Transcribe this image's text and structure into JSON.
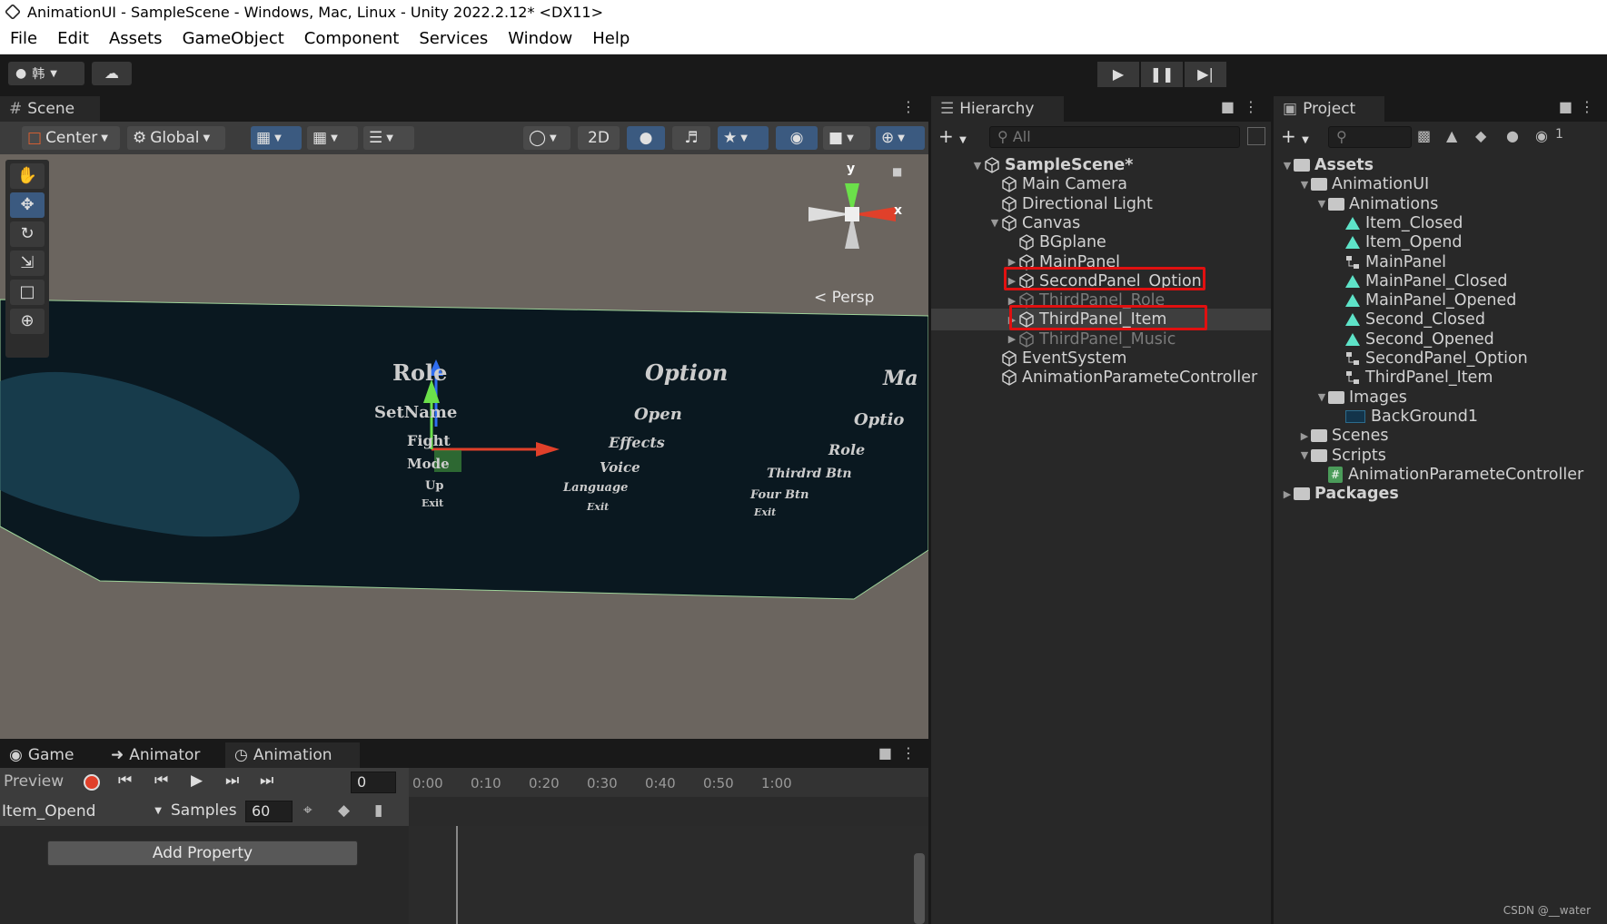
{
  "window": {
    "title": "AnimationUI - SampleScene - Windows, Mac, Linux - Unity 2022.2.12* <DX11>"
  },
  "menu": [
    "File",
    "Edit",
    "Assets",
    "GameObject",
    "Component",
    "Services",
    "Window",
    "Help"
  ],
  "toolbar": {
    "account": "韩",
    "play_icon": "play-icon",
    "pause_icon": "pause-icon",
    "step_icon": "step-icon"
  },
  "scene": {
    "tab": "Scene",
    "pivot": "Center",
    "space": "Global",
    "mode_2d": "2D",
    "persp_label": "< Persp",
    "gizmo_y": "y",
    "gizmo_x": "x",
    "labels_left": [
      "Role",
      "SetName",
      "Fight",
      "Mode",
      "Up",
      "Exit"
    ],
    "labels_mid": [
      "Option",
      "Open",
      "Effects",
      "Voice",
      "Language",
      "Exit"
    ],
    "labels_right": [
      "Ma",
      "Optio",
      "Role",
      "Thirdrd Btn",
      "Four Btn",
      "Exit"
    ]
  },
  "hierarchy": {
    "tab": "Hierarchy",
    "search_placeholder": "All",
    "items": [
      {
        "label": "SampleScene*",
        "depth": 0,
        "expanded": true,
        "bold": true
      },
      {
        "label": "Main Camera",
        "depth": 1
      },
      {
        "label": "Directional Light",
        "depth": 1
      },
      {
        "label": "Canvas",
        "depth": 1,
        "expanded": true
      },
      {
        "label": "BGplane",
        "depth": 2
      },
      {
        "label": "MainPanel",
        "depth": 2,
        "collapsed": true
      },
      {
        "label": "SecondPanel_Option",
        "depth": 2,
        "collapsed": true
      },
      {
        "label": "ThirdPanel_Role",
        "depth": 2,
        "collapsed": true,
        "inactive": true,
        "highlighted": true
      },
      {
        "label": "ThirdPanel_Item",
        "depth": 2,
        "collapsed": true,
        "selected": true
      },
      {
        "label": "ThirdPanel_Music",
        "depth": 2,
        "collapsed": true,
        "inactive": true,
        "highlighted": true
      },
      {
        "label": "EventSystem",
        "depth": 1
      },
      {
        "label": "AnimationParameteController",
        "depth": 1
      }
    ]
  },
  "project": {
    "tab": "Project",
    "badge": "1",
    "items": [
      {
        "label": "Assets",
        "depth": 0,
        "kind": "folder",
        "bold": true
      },
      {
        "label": "AnimationUI",
        "depth": 1,
        "kind": "folder"
      },
      {
        "label": "Animations",
        "depth": 2,
        "kind": "folder"
      },
      {
        "label": "Item_Closed",
        "depth": 3,
        "kind": "anim"
      },
      {
        "label": "Item_Opend",
        "depth": 3,
        "kind": "anim"
      },
      {
        "label": "MainPanel",
        "depth": 3,
        "kind": "controller"
      },
      {
        "label": "MainPanel_Closed",
        "depth": 3,
        "kind": "anim"
      },
      {
        "label": "MainPanel_Opened",
        "depth": 3,
        "kind": "anim"
      },
      {
        "label": "Second_Closed",
        "depth": 3,
        "kind": "anim"
      },
      {
        "label": "Second_Opened",
        "depth": 3,
        "kind": "anim"
      },
      {
        "label": "SecondPanel_Option",
        "depth": 3,
        "kind": "controller"
      },
      {
        "label": "ThirdPanel_Item",
        "depth": 3,
        "kind": "controller"
      },
      {
        "label": "Images",
        "depth": 2,
        "kind": "folder"
      },
      {
        "label": "BackGround1",
        "depth": 3,
        "kind": "image"
      },
      {
        "label": "Scenes",
        "depth": 1,
        "kind": "folder",
        "collapsed": true
      },
      {
        "label": "Scripts",
        "depth": 1,
        "kind": "folder"
      },
      {
        "label": "AnimationParameteController",
        "depth": 2,
        "kind": "script"
      },
      {
        "label": "Packages",
        "depth": 0,
        "kind": "folder",
        "bold": true,
        "collapsed": true
      }
    ]
  },
  "animation": {
    "tabs": {
      "game": "Game",
      "animator": "Animator",
      "animation": "Animation"
    },
    "preview": "Preview",
    "frame": "0",
    "clip": "Item_Opend",
    "samples_label": "Samples",
    "samples_value": "60",
    "add_property": "Add Property",
    "ticks": [
      "0:00",
      "0:10",
      "0:20",
      "0:30",
      "0:40",
      "0:50",
      "1:00"
    ]
  },
  "watermark": "CSDN @__water"
}
